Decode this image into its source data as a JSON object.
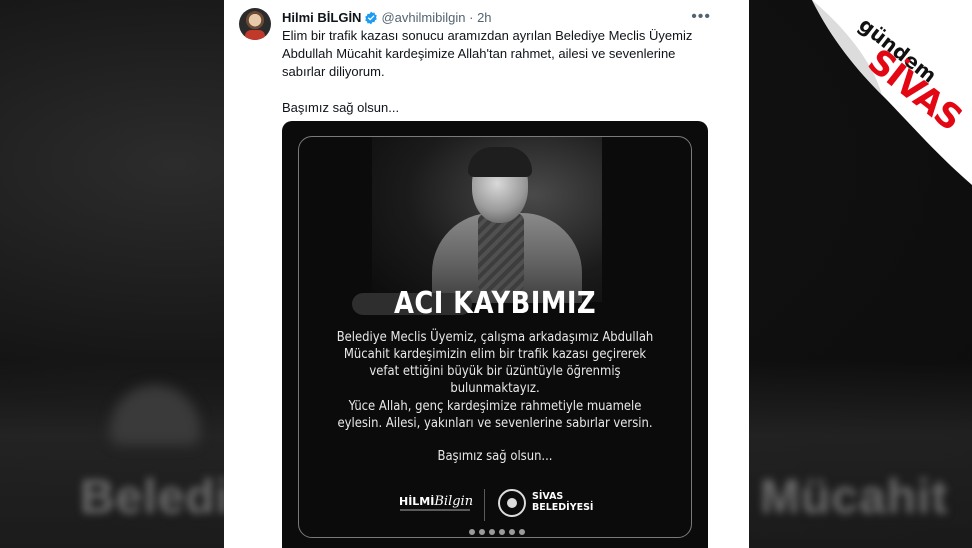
{
  "tweet": {
    "author_name": "Hilmi BİLGİN",
    "handle": "@avhilmibilgin",
    "separator": "·",
    "time": "2h",
    "more_icon": "ellipsis-icon",
    "verified_color": "#1d9bf0",
    "text_line_1": "Elim bir trafik kazası sonucu aramızdan ayrılan Belediye Meclis Üyemiz Abdullah Mücahit kardeşimize Allah'tan rahmet, ailesi ve sevenlerine sabırlar diliyorum.",
    "text_line_2": "Başımız sağ olsun..."
  },
  "media": {
    "title": "ACI KAYBIMIZ",
    "paragraph_1": "Belediye Meclis Üyemiz, çalışma arkadaşımız Abdullah Mücahit kardeşimizin elim bir trafik kazası geçirerek vefat ettiğini büyük bir üzüntüyle öğrenmiş bulunmaktayız.",
    "paragraph_2": "Yüce Allah, genç kardeşimize rahmetiyle muamele eylesin. Ailesi, yakınları ve sevenlerine sabırlar versin.",
    "paragraph_3": "Başımız sağ olsun...",
    "signature_name": "HİLMİ",
    "signature_script": "Bilgin",
    "municipality_line_1": "SİVAS",
    "municipality_line_2": "BELEDİYESİ"
  },
  "watermark": {
    "brand_top": "gündem",
    "brand_main": "SİVAS",
    "brand_color": "#e30613"
  },
  "background": {
    "blur_text_left": "Belediye",
    "blur_text_right": "Mücahit"
  }
}
